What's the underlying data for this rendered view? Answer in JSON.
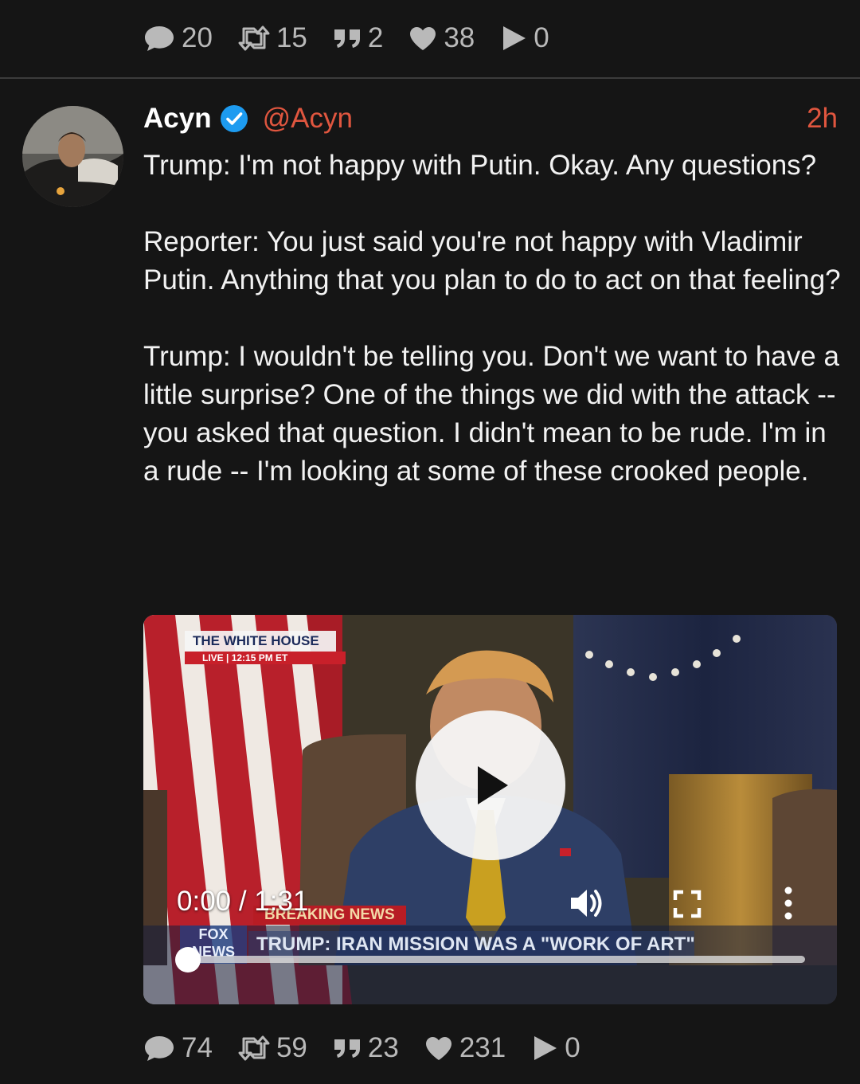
{
  "top_stats": {
    "replies": "20",
    "reposts": "15",
    "quotes": "2",
    "likes": "38",
    "views": "0"
  },
  "post": {
    "display_name": "Acyn",
    "handle": "@Acyn",
    "time": "2h",
    "paragraphs": [
      "Trump: I'm not happy with Putin. Okay. Any questions?",
      "Reporter: You just said you're not happy with Vladimir Putin. Anything that you plan to do to act on that feeling?",
      "Trump: I wouldn't be telling you. Don't we want to have a little surprise? One of the things we did with the attack -- you asked that question. I didn't mean to be rude. I'm in a rude -- I'm looking at some of these crooked people."
    ]
  },
  "video": {
    "time_display": "0:00 / 1:31",
    "progress": 0.0,
    "overlay": {
      "network_label": "THE WHITE HOUSE",
      "live_label": "LIVE | 12:15 PM ET",
      "breaking": "BREAKING NEWS",
      "headline": "TRUMP: IRAN MISSION WAS A \"WORK OF ART\"",
      "channel": "FOX NEWS"
    }
  },
  "bottom_stats": {
    "replies": "74",
    "reposts": "59",
    "quotes": "23",
    "likes": "231",
    "views": "0"
  },
  "colors": {
    "background": "#151515",
    "accent": "#e0563f",
    "verified": "#1d9bf0",
    "muted": "#b9b9b9"
  }
}
